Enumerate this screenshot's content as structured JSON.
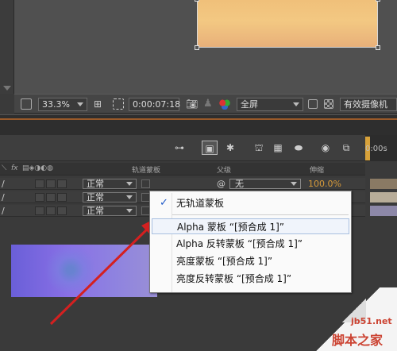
{
  "viewer": {
    "zoom": "33.3%",
    "timecode": "0:00:07:18",
    "resolution": "全屏",
    "camera": "有效摄像机"
  },
  "timeline": {
    "ruler_label": "0:00s",
    "header": {
      "fx": "fx",
      "track_matte": "轨道蒙板",
      "parent": "父级",
      "stretch": "伸缩"
    },
    "layers": [
      {
        "mode": "正常",
        "parent": "无",
        "stretch": "100.0%"
      },
      {
        "mode": "正常"
      },
      {
        "mode": "正常"
      }
    ]
  },
  "context_menu": {
    "items": [
      {
        "label": "无轨道蒙板",
        "checked": true
      },
      {
        "label": "Alpha 蒙板 “[预合成 1]”",
        "highlighted": true
      },
      {
        "label": "Alpha 反转蒙板 “[预合成 1]”"
      },
      {
        "label": "亮度蒙板 “[预合成 1]”"
      },
      {
        "label": "亮度反转蒙板 “[预合成 1]”"
      }
    ]
  },
  "watermark": {
    "site": "jb51.net",
    "name": "脚本之家"
  },
  "colors": {
    "accent_orange": "#d69a3a",
    "menu_check": "#1d58c8",
    "watermark": "#c43"
  }
}
